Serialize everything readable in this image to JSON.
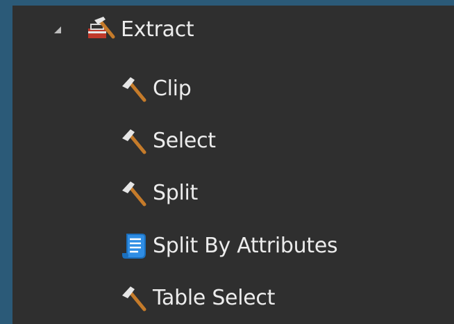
{
  "tree": {
    "group": {
      "label": "Extract",
      "icon": "toolbox-icon",
      "expanded": true
    },
    "items": [
      {
        "label": "Clip",
        "icon": "hammer-icon"
      },
      {
        "label": "Select",
        "icon": "hammer-icon"
      },
      {
        "label": "Split",
        "icon": "hammer-icon"
      },
      {
        "label": "Split By Attributes",
        "icon": "script-icon"
      },
      {
        "label": "Table Select",
        "icon": "hammer-icon"
      }
    ]
  },
  "colors": {
    "background": "#2b5a78",
    "panel": "#2f2f2f",
    "text": "#ececec",
    "script_icon": "#2f8de4"
  }
}
